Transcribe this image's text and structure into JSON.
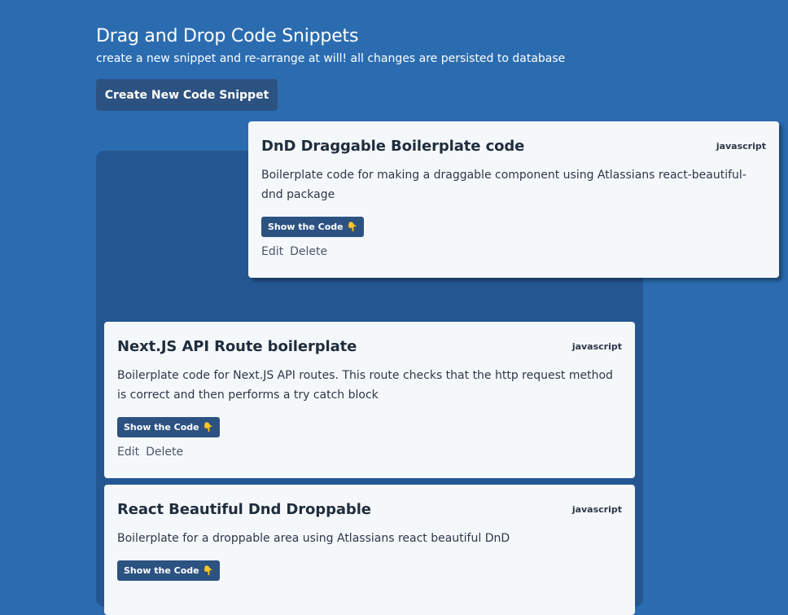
{
  "header": {
    "title": "Drag and Drop Code Snippets",
    "subtitle": "create a new snippet and re-arrange at will! all changes are persisted to database"
  },
  "create_button_label": "Create New Code Snippet",
  "snippets": [
    {
      "title": "DnD Draggable Boilerplate code",
      "language": "javascript",
      "description": "Boilerplate code for making a draggable component using Atlassians react-beautiful-dnd package",
      "show_label": "Show the Code",
      "show_icon": "pointing-down-icon",
      "edit_label": "Edit",
      "delete_label": "Delete",
      "state": "dragging"
    },
    {
      "title": "Next.JS API Route boilerplate",
      "language": "javascript",
      "description": "Boilerplate code for Next.JS API routes. This route checks that the http request method is correct and then performs a try catch block",
      "show_label": "Show the Code",
      "show_icon": "pointing-down-icon",
      "edit_label": "Edit",
      "delete_label": "Delete"
    },
    {
      "title": "React Beautiful Dnd Droppable",
      "language": "javascript",
      "description": "Boilerplate for a droppable area using Atlassians react beautiful DnD",
      "show_label": "Show the Code",
      "show_icon": "pointing-down-icon"
    }
  ],
  "colors": {
    "page_background": "#2b6cb0",
    "drop_area_background": "#245792",
    "button_background": "#2c5282",
    "card_background": "#f5f8fb"
  }
}
